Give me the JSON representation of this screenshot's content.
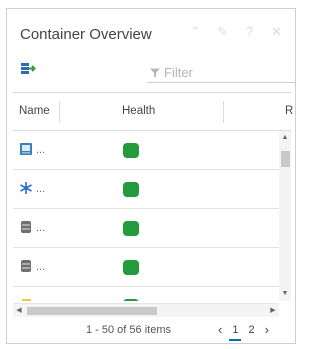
{
  "panel": {
    "title": "Container Overview",
    "header_icons": [
      "chevrons-up-icon",
      "pencil-icon",
      "help-icon",
      "close-icon"
    ],
    "header_glyphs": {
      "collapse": "⌃",
      "edit": "✎",
      "help": "?",
      "close": "✕"
    }
  },
  "toolbar": {
    "filter_placeholder": "Filter",
    "export_icon": "export-icon"
  },
  "table": {
    "columns": [
      "Name",
      "Health",
      "R"
    ],
    "rows": [
      {
        "name": "...",
        "icon": "vm-icon",
        "health_color": "#239a3b"
      },
      {
        "name": "...",
        "icon": "snowflake-icon",
        "health_color": "#239a3b"
      },
      {
        "name": "...",
        "icon": "datastore-icon",
        "health_color": "#239a3b"
      },
      {
        "name": "...",
        "icon": "datastore-icon",
        "health_color": "#239a3b"
      },
      {
        "name": "...",
        "icon": "folder-icon",
        "health_color": "#239a3b"
      }
    ]
  },
  "footer": {
    "item_count": "1 - 50 of 56 items",
    "prev": "‹",
    "next": "›",
    "pages": [
      "1",
      "2"
    ],
    "current_page": "1"
  },
  "colors": {
    "health_ok": "#239a3b",
    "accent": "#0072a3"
  }
}
